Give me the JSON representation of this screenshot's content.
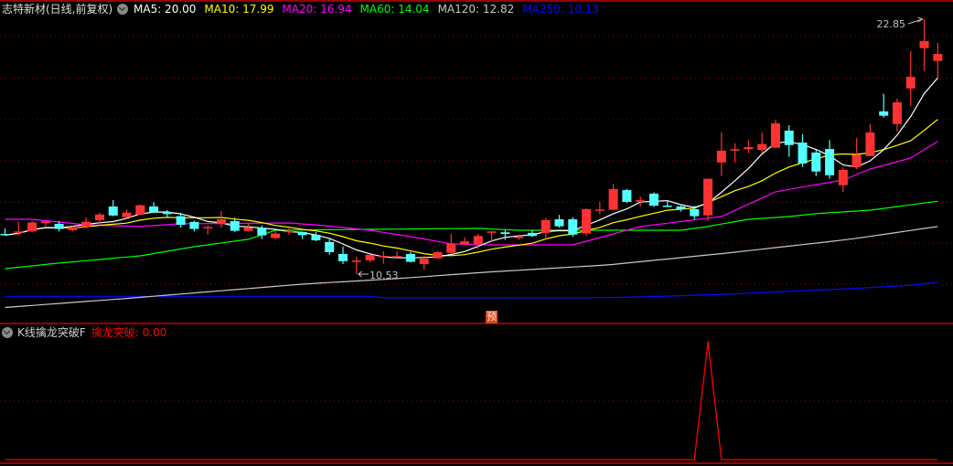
{
  "header": {
    "title": "志特新材(日线,前复权)",
    "ma": [
      {
        "label": "MA5: 20.00",
        "color": "#ffffff"
      },
      {
        "label": "MA10: 17.99",
        "color": "#ffff00"
      },
      {
        "label": "MA20: 16.94",
        "color": "#ff00ff"
      },
      {
        "label": "MA60: 14.04",
        "color": "#00ff00"
      },
      {
        "label": "MA120: 12.82",
        "color": "#c8c8c8"
      },
      {
        "label": "MA250: 10.13",
        "color": "#0a0aff"
      }
    ]
  },
  "indicator_header": {
    "name": "K线擒龙突破F",
    "value_label": "擒龙突破: 0.00"
  },
  "marker": {
    "text": "预",
    "index": 36
  },
  "colors": {
    "up": "#ff3232",
    "down": "#54ffff",
    "grid": "#8c0000",
    "separator": "#c80000",
    "indicator": "#ff0000"
  },
  "chart_data": [
    {
      "type": "candlestick",
      "fields": [
        "open",
        "close",
        "high",
        "low"
      ],
      "candles": [
        [
          12.46,
          12.4,
          12.73,
          12.37
        ],
        [
          12.54,
          12.58,
          13.05,
          12.36
        ],
        [
          12.58,
          13.01,
          13.1,
          12.54
        ],
        [
          12.98,
          13.07,
          13.09,
          12.83
        ],
        [
          12.95,
          12.7,
          13.09,
          12.58
        ],
        [
          12.64,
          12.79,
          12.83,
          12.58
        ],
        [
          12.79,
          13.05,
          13.27,
          12.73
        ],
        [
          13.13,
          13.4,
          13.49,
          12.87
        ],
        [
          13.79,
          13.35,
          14.1,
          13.32
        ],
        [
          13.27,
          13.49,
          13.64,
          13.23
        ],
        [
          13.39,
          13.85,
          13.88,
          13.36
        ],
        [
          13.79,
          13.49,
          14.0,
          13.47
        ],
        [
          13.52,
          13.42,
          13.61,
          13.25
        ],
        [
          13.32,
          12.9,
          13.49,
          12.77
        ],
        [
          13.04,
          12.7,
          13.1,
          12.58
        ],
        [
          12.77,
          12.79,
          12.87,
          12.43
        ],
        [
          12.94,
          13.17,
          13.57,
          12.76
        ],
        [
          13.08,
          12.61,
          13.25,
          12.55
        ],
        [
          12.61,
          12.77,
          12.95,
          12.58
        ],
        [
          12.76,
          12.39,
          12.87,
          12.21
        ],
        [
          12.26,
          12.48,
          12.58,
          12.21
        ],
        [
          12.56,
          12.61,
          12.73,
          12.43
        ],
        [
          12.55,
          12.4,
          12.58,
          12.21
        ],
        [
          12.42,
          12.15,
          12.55,
          12.11
        ],
        [
          12.07,
          11.58,
          12.27,
          11.45
        ],
        [
          11.49,
          11.14,
          11.84,
          11.0
        ],
        [
          11.11,
          11.17,
          11.36,
          10.53
        ],
        [
          11.18,
          11.45,
          11.48,
          11.08
        ],
        [
          11.36,
          11.4,
          11.62,
          11.02
        ],
        [
          11.36,
          11.39,
          11.62,
          11.31
        ],
        [
          11.49,
          11.11,
          11.58,
          11.08
        ],
        [
          11.0,
          11.26,
          11.4,
          10.74
        ],
        [
          11.28,
          11.58,
          11.62,
          11.26
        ],
        [
          11.55,
          11.99,
          12.46,
          11.53
        ],
        [
          11.96,
          12.1,
          12.29,
          11.96
        ],
        [
          11.96,
          12.36,
          12.46,
          11.74
        ],
        [
          12.54,
          12.58,
          12.6,
          12.07
        ],
        [
          12.54,
          12.46,
          12.65,
          12.17
        ],
        [
          12.26,
          12.32,
          12.43,
          12.17
        ],
        [
          12.51,
          12.36,
          12.65,
          12.32
        ],
        [
          12.51,
          13.13,
          13.25,
          12.21
        ],
        [
          13.17,
          12.83,
          13.38,
          12.76
        ],
        [
          13.17,
          12.43,
          13.27,
          12.32
        ],
        [
          12.48,
          13.66,
          13.69,
          12.36
        ],
        [
          13.58,
          13.64,
          14.01,
          13.42
        ],
        [
          13.63,
          14.63,
          14.89,
          13.61
        ],
        [
          14.58,
          14.01,
          14.64,
          13.95
        ],
        [
          14.01,
          14.09,
          14.27,
          13.79
        ],
        [
          14.41,
          13.83,
          14.47,
          13.76
        ],
        [
          13.83,
          13.79,
          14.09,
          13.76
        ],
        [
          13.79,
          13.66,
          13.83,
          13.54
        ],
        [
          13.66,
          13.32,
          13.83,
          13.17
        ],
        [
          13.36,
          15.13,
          15.13,
          13.09
        ],
        [
          15.92,
          16.49,
          17.37,
          15.26
        ],
        [
          16.49,
          16.56,
          16.84,
          15.92
        ],
        [
          16.56,
          16.66,
          17.0,
          16.37
        ],
        [
          16.53,
          16.81,
          17.37,
          16.37
        ],
        [
          16.63,
          17.81,
          17.99,
          16.62
        ],
        [
          17.46,
          16.76,
          17.72,
          16.19
        ],
        [
          16.88,
          15.87,
          17.29,
          15.7
        ],
        [
          16.4,
          15.48,
          16.52,
          15.26
        ],
        [
          16.57,
          15.3,
          17.0,
          15.13
        ],
        [
          14.82,
          15.56,
          15.68,
          14.49
        ],
        [
          15.7,
          16.28,
          17.1,
          15.6
        ],
        [
          16.23,
          17.37,
          17.77,
          16.22
        ],
        [
          18.39,
          18.18,
          19.24,
          18.09
        ],
        [
          17.78,
          18.83,
          19.02,
          17.41
        ],
        [
          19.5,
          20.06,
          21.3,
          18.65
        ],
        [
          21.45,
          21.79,
          22.85,
          20.34
        ],
        [
          20.83,
          21.17,
          21.7,
          20.02
        ]
      ],
      "ma_series": {
        "MA20": [
          [
            0,
            13.17
          ],
          [
            2,
            13.17
          ],
          [
            6,
            12.9
          ],
          [
            10,
            12.82
          ],
          [
            13,
            12.95
          ],
          [
            21,
            12.99
          ],
          [
            23,
            12.9
          ],
          [
            27,
            12.64
          ],
          [
            30,
            12.33
          ],
          [
            33,
            11.98
          ],
          [
            35,
            11.93
          ],
          [
            42,
            11.93
          ],
          [
            47,
            12.82
          ],
          [
            53,
            13.3
          ],
          [
            57,
            14.5
          ],
          [
            62,
            15.07
          ],
          [
            64,
            15.6
          ],
          [
            67,
            16.13
          ],
          [
            69,
            16.94
          ]
        ],
        "MA60": [
          [
            0,
            10.78
          ],
          [
            4,
            11.05
          ],
          [
            10,
            11.4
          ],
          [
            14,
            11.84
          ],
          [
            18,
            12.2
          ],
          [
            20,
            12.64
          ],
          [
            35,
            12.73
          ],
          [
            38,
            12.64
          ],
          [
            50,
            12.64
          ],
          [
            52,
            12.82
          ],
          [
            55,
            13.17
          ],
          [
            58,
            13.3
          ],
          [
            60,
            13.44
          ],
          [
            64,
            13.61
          ],
          [
            69,
            14.04
          ]
        ],
        "MA120": [
          [
            0,
            8.9
          ],
          [
            8.6,
            9.32
          ],
          [
            22,
            10.03
          ],
          [
            29,
            10.3
          ],
          [
            35.6,
            10.61
          ],
          [
            44.6,
            10.96
          ],
          [
            53.5,
            11.54
          ],
          [
            62.5,
            12.2
          ],
          [
            69,
            12.82
          ]
        ],
        "MA250": [
          [
            0,
            9.44
          ],
          [
            27,
            9.44
          ],
          [
            28,
            9.37
          ],
          [
            43,
            9.37
          ],
          [
            47,
            9.41
          ],
          [
            53.7,
            9.55
          ],
          [
            57.8,
            9.68
          ],
          [
            62.5,
            9.81
          ],
          [
            67.3,
            9.99
          ],
          [
            69,
            10.13
          ]
        ]
      },
      "annotations": {
        "high": "22.85",
        "high_index": 68,
        "low": "10.53",
        "low_index": 26
      }
    },
    {
      "type": "line",
      "name": "擒龙突破",
      "values": [
        0,
        0,
        0,
        0,
        0,
        0,
        0,
        0,
        0,
        0,
        0,
        0,
        0,
        0,
        0,
        0,
        0,
        0,
        0,
        0,
        0,
        0,
        0,
        0,
        0,
        0,
        0,
        0,
        0,
        0,
        0,
        0,
        0,
        0,
        0,
        0,
        0,
        0,
        0,
        0,
        0,
        0,
        0,
        0,
        0,
        0,
        0,
        0,
        0,
        0,
        0,
        0,
        1,
        0,
        0,
        0,
        0,
        0,
        0,
        0,
        0,
        0,
        0,
        0,
        0,
        0,
        0,
        0,
        0,
        0
      ]
    }
  ]
}
